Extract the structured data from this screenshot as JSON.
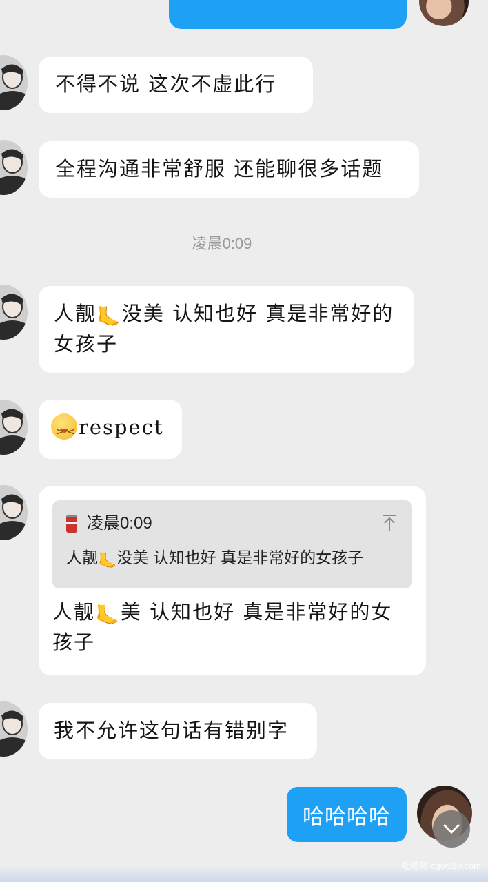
{
  "messages": [
    {
      "text": "不得不说 这次不虚此行"
    },
    {
      "text": "全程沟通非常舒服 还能聊很多话题"
    },
    {
      "text_a": "人靓",
      "emoji": "🦶",
      "text_b": "没美 认知也好 真是非常好的女孩子"
    },
    {
      "text": "respect"
    },
    {
      "quote_author": "凌晨0:09",
      "quote_a": "人靓",
      "quote_emoji": "🦶",
      "quote_b": "没美 认知也好 真是非常好的女孩子",
      "reply_a": "人靓",
      "reply_emoji": "🦶",
      "reply_b": "美 认知也好 真是非常好的女孩子"
    },
    {
      "text": "我不允许这句话有错别字"
    }
  ],
  "timestamp": "凌晨0:09",
  "outgoing": {
    "text": "哈哈哈哈"
  },
  "watermark": "吃瓜网 cgw520.com",
  "icons": {
    "face": "grinning-squint-face-icon",
    "foot": "foot-icon",
    "can": "canned-food-icon",
    "collapse": "collapse-up-icon",
    "scroll": "chevron-down-icon"
  },
  "colors": {
    "accent": "#1ea1f5",
    "background": "#ededed",
    "bubble": "#ffffff",
    "quote_bg": "#e3e3e3"
  }
}
